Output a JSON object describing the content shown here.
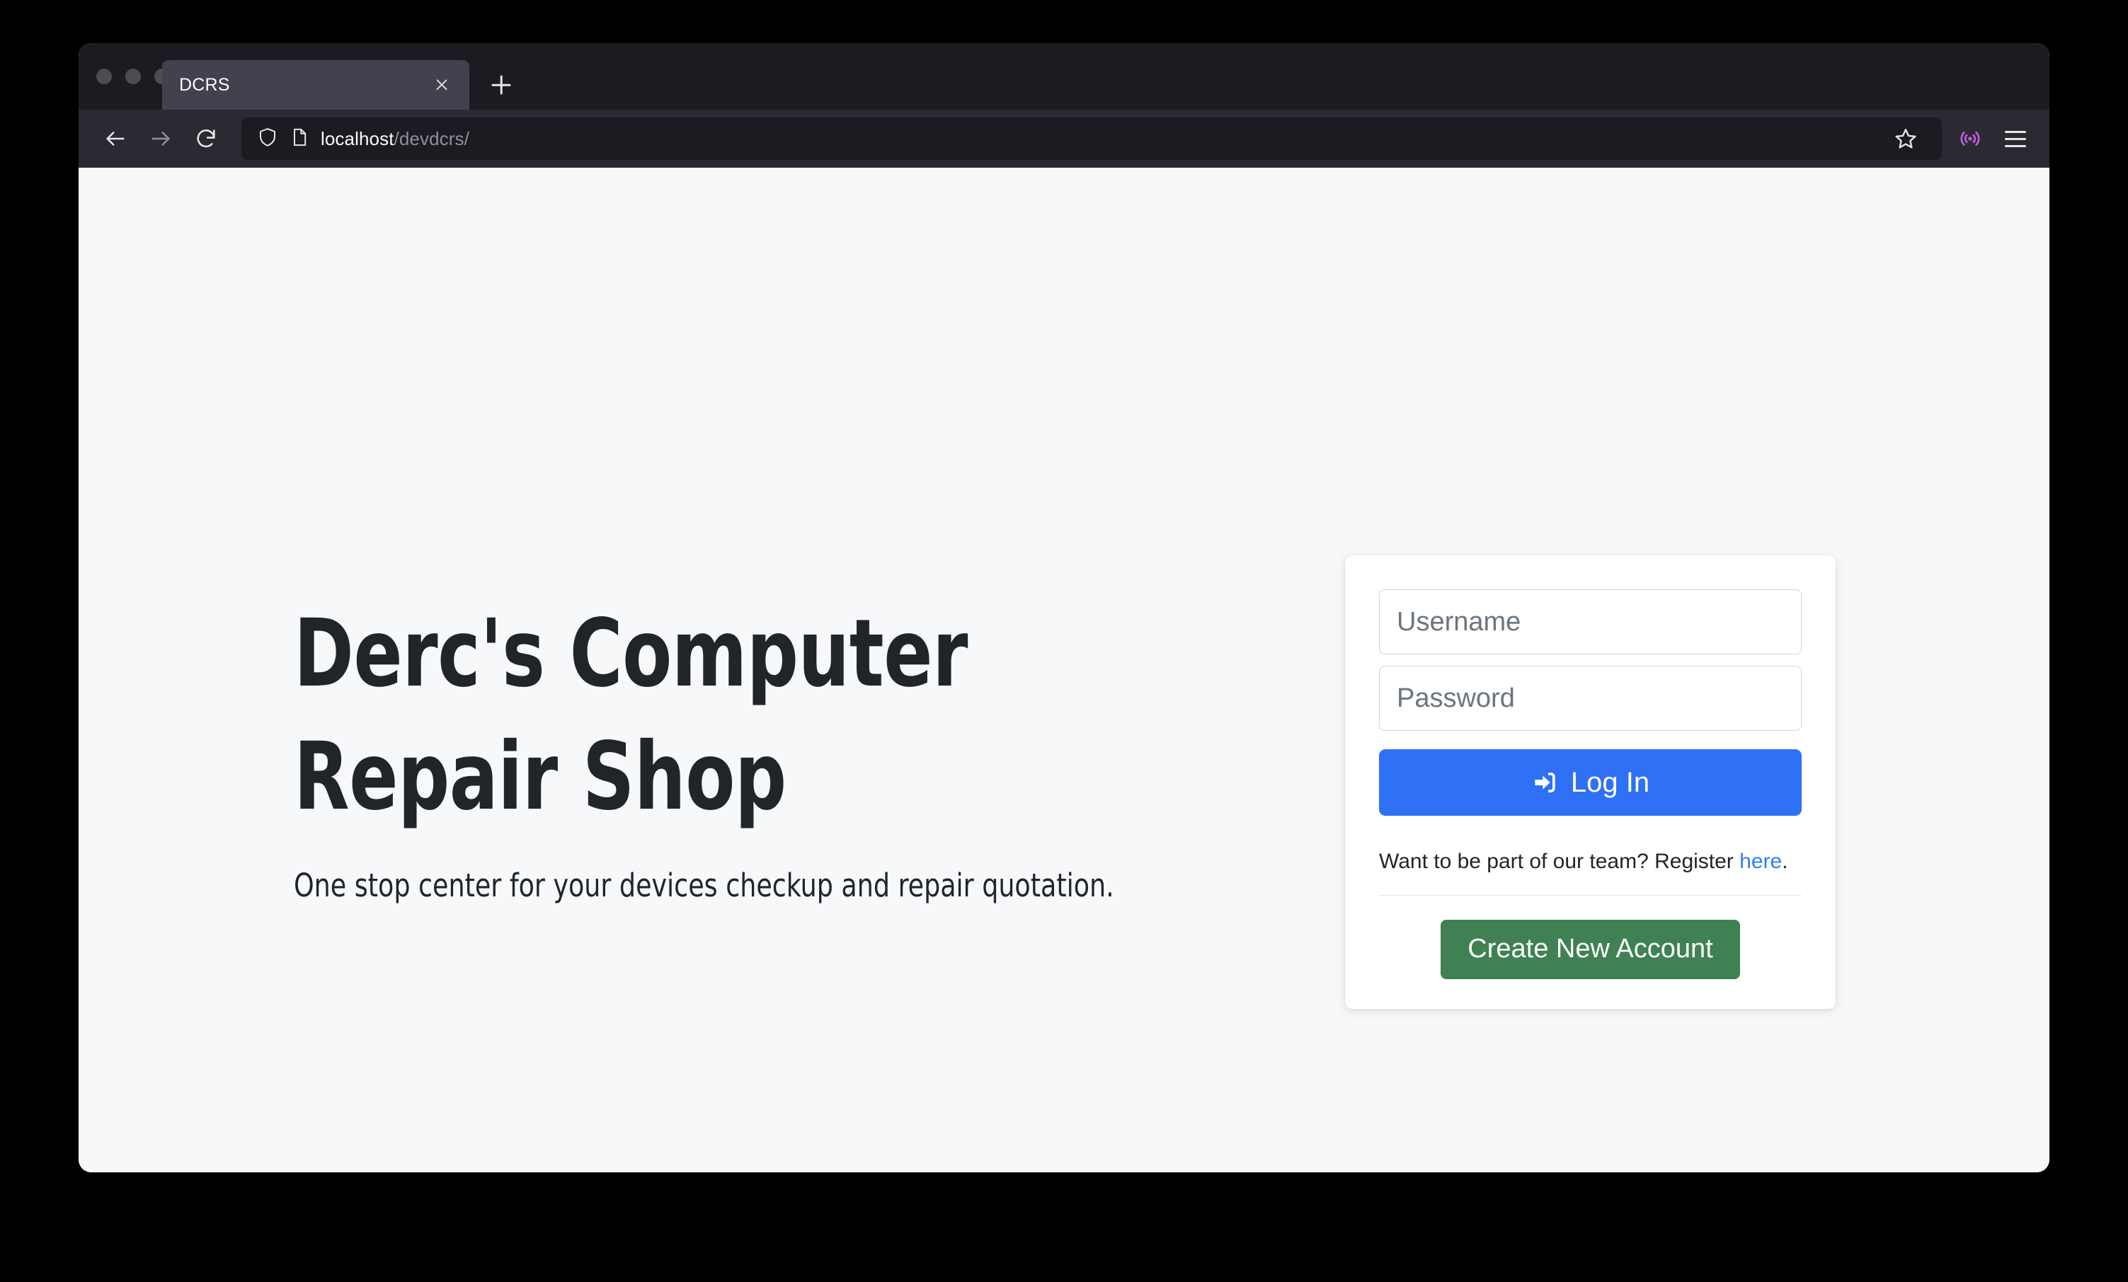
{
  "browser": {
    "window_controls": [
      "close",
      "minimize",
      "maximize"
    ],
    "tabs": [
      {
        "title": "DCRS",
        "close_label": "×",
        "active": true
      }
    ],
    "new_tab_label": "+",
    "nav": {
      "back_label": "Back",
      "forward_label": "Forward",
      "reload_label": "Reload"
    },
    "url_bar": {
      "host": "localhost",
      "path": "/devdcrs/",
      "shield_icon": "shield-icon",
      "page_icon": "page-icon"
    },
    "toolbar_icons": {
      "bookmark": "star-icon",
      "pocket": "broadcast-icon",
      "menu": "hamburger-icon"
    },
    "colors": {
      "tab_strip_bg": "#1C1B22",
      "toolbar_bg": "#2B2A33",
      "active_tab_bg": "#42414D",
      "urlbar_bg": "#1C1B22",
      "pocket_accent": "#C05DE0"
    }
  },
  "page": {
    "background": "#F7F8FA",
    "hero": {
      "title_line1": "Derc's Computer",
      "title_line2": "Repair Shop",
      "subtitle": "One stop center for your devices checkup and repair quotation."
    },
    "login_card": {
      "username_placeholder": "Username",
      "username_value": "",
      "password_placeholder": "Password",
      "password_value": "",
      "login_button_label": "Log In",
      "login_icon": "sign-in-icon",
      "register_prompt": "Want to be part of our team? Register ",
      "register_link_label": "here",
      "register_suffix": ".",
      "create_account_label": "Create New Account",
      "colors": {
        "login_button": "#3070F5",
        "create_account_button": "#3F8152",
        "link": "#2E7FF7"
      }
    }
  }
}
